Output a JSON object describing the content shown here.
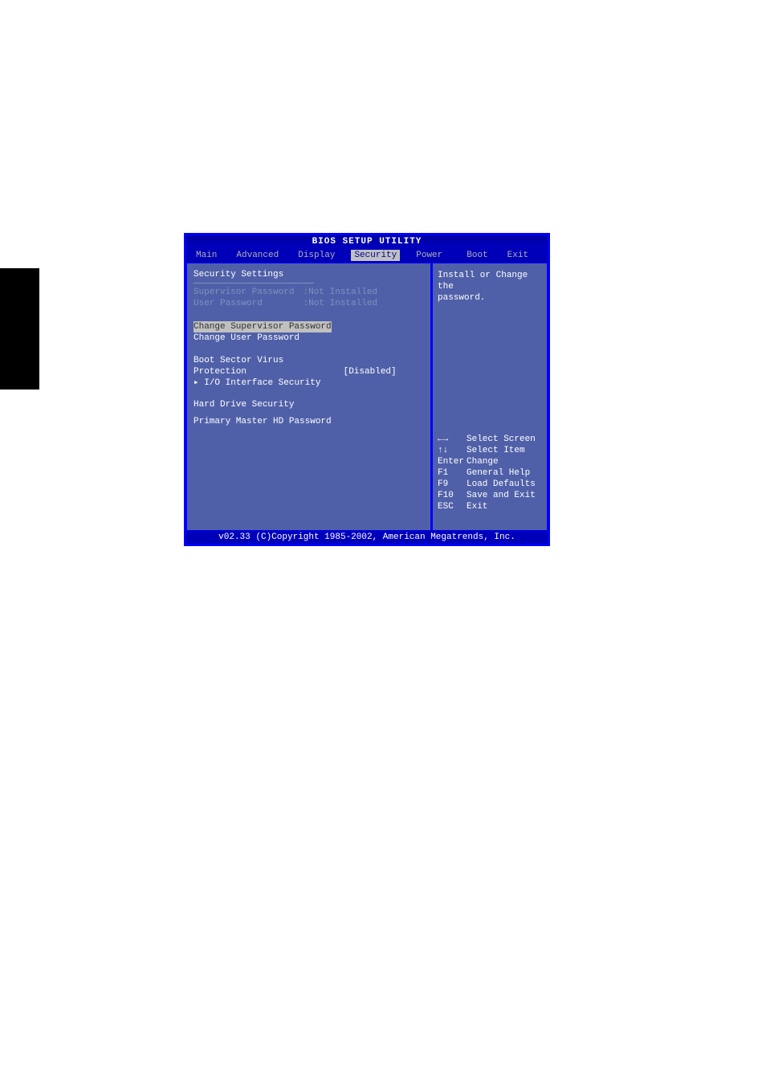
{
  "title": "BIOS SETUP UTILITY",
  "menu": {
    "items": [
      "Main",
      "Advanced",
      "Display",
      "Security",
      "Power",
      "Boot",
      "Exit"
    ],
    "active_index": 3
  },
  "content": {
    "heading": "Security Settings",
    "supervisor_label": "Supervisor Password",
    "supervisor_value": ":Not Installed",
    "user_label": "User Password",
    "user_value": ":Not Installed",
    "change_supervisor": "Change Supervisor Password",
    "change_user": "Change User Password",
    "boot_sector_label": "Boot Sector Virus Protection",
    "boot_sector_value": "[Disabled]",
    "io_interface": "I/O Interface Security",
    "hd_security": "Hard Drive Security",
    "primary_hd": "Primary Master HD Password"
  },
  "help": {
    "text_line1": "Install or Change the",
    "text_line2": "password.",
    "keys": [
      {
        "key": "←→",
        "desc": "Select Screen"
      },
      {
        "key": "↑↓",
        "desc": "Select Item"
      },
      {
        "key": "Enter",
        "desc": "Change"
      },
      {
        "key": "F1",
        "desc": "General Help"
      },
      {
        "key": "F9",
        "desc": "Load Defaults"
      },
      {
        "key": "F10",
        "desc": "Save and Exit"
      },
      {
        "key": "ESC",
        "desc": "Exit"
      }
    ]
  },
  "footer": "v02.33 (C)Copyright 1985-2002, American Megatrends, Inc."
}
